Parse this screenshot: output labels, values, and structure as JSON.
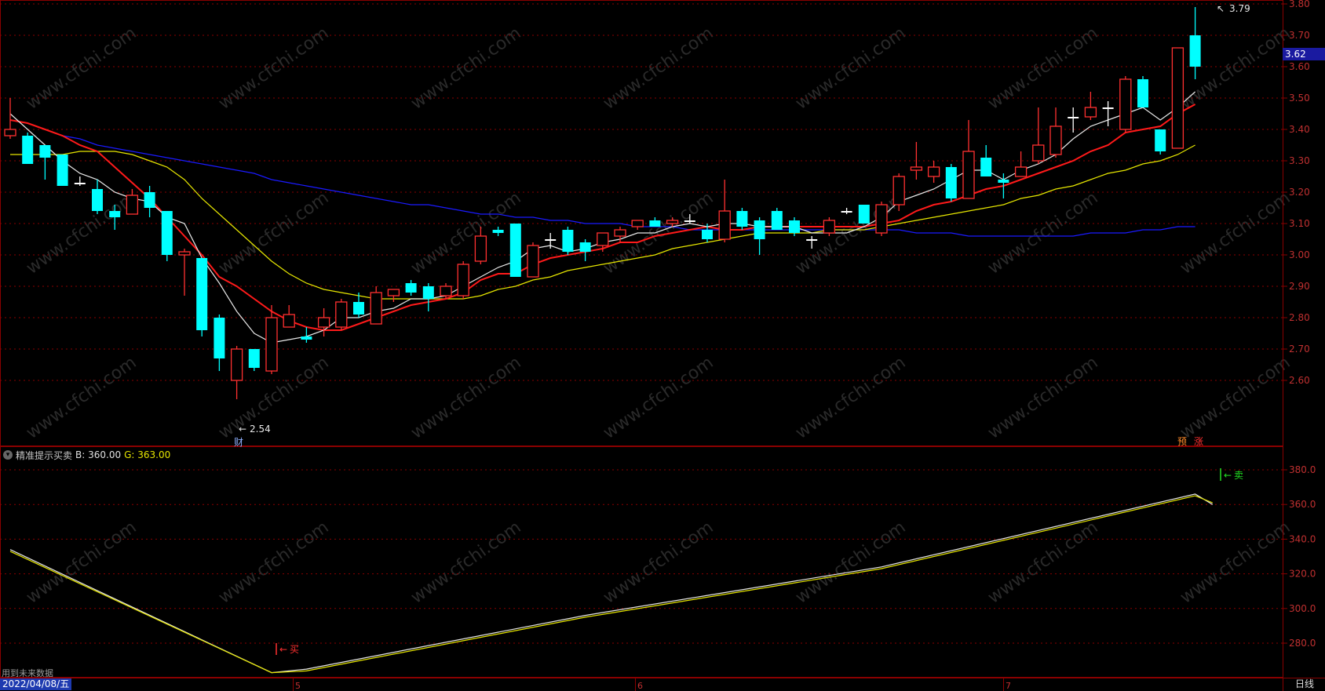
{
  "main_axis": {
    "ticks": [
      "3.80",
      "3.70",
      "3.60",
      "3.50",
      "3.40",
      "3.30",
      "3.20",
      "3.10",
      "3.00",
      "2.90",
      "2.80",
      "2.70",
      "2.60"
    ],
    "current_price": "3.62",
    "high_label": "3.79",
    "low_label": "2.54"
  },
  "markers": {
    "finance": "财",
    "forecast": "预",
    "rise": "涨"
  },
  "indicator": {
    "name": "精准提示买卖",
    "b_label": "B: 360.00",
    "g_label": "G: 363.00",
    "buy_signal": "买",
    "sell_signal": "卖",
    "axis_ticks": [
      "380.0",
      "360.0",
      "340.0",
      "320.0",
      "300.0",
      "280.0"
    ],
    "future_note": "用到未来数据"
  },
  "time_axis": {
    "date_label": "2022/04/08/五",
    "month_ticks": [
      "5",
      "6",
      "7"
    ],
    "period": "日线"
  },
  "watermark": "www.cfchi.com",
  "colors": {
    "up": "#ff3030",
    "down": "#00ffff",
    "ma5": "#e8e8e8",
    "ma10": "#ff1a1a",
    "ma20": "#e6e600",
    "ma60": "#1a1aff",
    "grid": "#8a0000"
  },
  "chart_data": {
    "type": "candlestick",
    "candles": [
      {
        "o": 3.38,
        "h": 3.5,
        "l": 3.37,
        "c": 3.4
      },
      {
        "o": 3.38,
        "h": 3.39,
        "l": 3.29,
        "c": 3.29
      },
      {
        "o": 3.35,
        "h": 3.35,
        "l": 3.24,
        "c": 3.31
      },
      {
        "o": 3.32,
        "h": 3.32,
        "l": 3.22,
        "c": 3.22
      },
      {
        "o": 3.23,
        "h": 3.25,
        "l": 3.22,
        "c": 3.23
      },
      {
        "o": 3.21,
        "h": 3.24,
        "l": 3.13,
        "c": 3.14
      },
      {
        "o": 3.14,
        "h": 3.16,
        "l": 3.08,
        "c": 3.12
      },
      {
        "o": 3.13,
        "h": 3.21,
        "l": 3.13,
        "c": 3.19
      },
      {
        "o": 3.2,
        "h": 3.22,
        "l": 3.12,
        "c": 3.15
      },
      {
        "o": 3.14,
        "h": 3.14,
        "l": 2.98,
        "c": 3.0
      },
      {
        "o": 3.0,
        "h": 3.02,
        "l": 2.87,
        "c": 3.01
      },
      {
        "o": 2.99,
        "h": 2.99,
        "l": 2.74,
        "c": 2.76
      },
      {
        "o": 2.8,
        "h": 2.81,
        "l": 2.63,
        "c": 2.67
      },
      {
        "o": 2.6,
        "h": 2.71,
        "l": 2.54,
        "c": 2.7
      },
      {
        "o": 2.7,
        "h": 2.7,
        "l": 2.63,
        "c": 2.64
      },
      {
        "o": 2.63,
        "h": 2.84,
        "l": 2.62,
        "c": 2.8
      },
      {
        "o": 2.77,
        "h": 2.84,
        "l": 2.77,
        "c": 2.81
      },
      {
        "o": 2.74,
        "h": 2.77,
        "l": 2.72,
        "c": 2.73
      },
      {
        "o": 2.77,
        "h": 2.83,
        "l": 2.74,
        "c": 2.8
      },
      {
        "o": 2.77,
        "h": 2.86,
        "l": 2.76,
        "c": 2.85
      },
      {
        "o": 2.85,
        "h": 2.88,
        "l": 2.8,
        "c": 2.81
      },
      {
        "o": 2.78,
        "h": 2.9,
        "l": 2.78,
        "c": 2.88
      },
      {
        "o": 2.87,
        "h": 2.89,
        "l": 2.85,
        "c": 2.89
      },
      {
        "o": 2.91,
        "h": 2.92,
        "l": 2.87,
        "c": 2.88
      },
      {
        "o": 2.9,
        "h": 2.91,
        "l": 2.82,
        "c": 2.86
      },
      {
        "o": 2.87,
        "h": 2.91,
        "l": 2.86,
        "c": 2.9
      },
      {
        "o": 2.87,
        "h": 2.98,
        "l": 2.86,
        "c": 2.97
      },
      {
        "o": 2.98,
        "h": 3.09,
        "l": 2.97,
        "c": 3.06
      },
      {
        "o": 3.08,
        "h": 3.09,
        "l": 3.06,
        "c": 3.07
      },
      {
        "o": 3.1,
        "h": 3.1,
        "l": 2.93,
        "c": 2.93
      },
      {
        "o": 2.93,
        "h": 3.04,
        "l": 2.93,
        "c": 3.03
      },
      {
        "o": 3.05,
        "h": 3.07,
        "l": 3.02,
        "c": 3.05
      },
      {
        "o": 3.08,
        "h": 3.09,
        "l": 3.0,
        "c": 3.01
      },
      {
        "o": 3.04,
        "h": 3.05,
        "l": 2.98,
        "c": 3.01
      },
      {
        "o": 3.03,
        "h": 3.07,
        "l": 3.01,
        "c": 3.07
      },
      {
        "o": 3.06,
        "h": 3.09,
        "l": 3.04,
        "c": 3.08
      },
      {
        "o": 3.09,
        "h": 3.11,
        "l": 3.08,
        "c": 3.11
      },
      {
        "o": 3.11,
        "h": 3.12,
        "l": 3.09,
        "c": 3.09
      },
      {
        "o": 3.1,
        "h": 3.12,
        "l": 3.09,
        "c": 3.11
      },
      {
        "o": 3.11,
        "h": 3.13,
        "l": 3.1,
        "c": 3.11
      },
      {
        "o": 3.08,
        "h": 3.1,
        "l": 3.04,
        "c": 3.05
      },
      {
        "o": 3.05,
        "h": 3.24,
        "l": 3.04,
        "c": 3.14
      },
      {
        "o": 3.14,
        "h": 3.15,
        "l": 3.08,
        "c": 3.09
      },
      {
        "o": 3.11,
        "h": 3.12,
        "l": 3.0,
        "c": 3.05
      },
      {
        "o": 3.14,
        "h": 3.15,
        "l": 3.08,
        "c": 3.08
      },
      {
        "o": 3.11,
        "h": 3.12,
        "l": 3.06,
        "c": 3.07
      },
      {
        "o": 3.05,
        "h": 3.06,
        "l": 3.02,
        "c": 3.05
      },
      {
        "o": 3.07,
        "h": 3.12,
        "l": 3.06,
        "c": 3.11
      },
      {
        "o": 3.14,
        "h": 3.15,
        "l": 3.13,
        "c": 3.14
      },
      {
        "o": 3.16,
        "h": 3.16,
        "l": 3.1,
        "c": 3.1
      },
      {
        "o": 3.07,
        "h": 3.17,
        "l": 3.06,
        "c": 3.16
      },
      {
        "o": 3.16,
        "h": 3.26,
        "l": 3.14,
        "c": 3.25
      },
      {
        "o": 3.27,
        "h": 3.36,
        "l": 3.24,
        "c": 3.28
      },
      {
        "o": 3.25,
        "h": 3.3,
        "l": 3.23,
        "c": 3.28
      },
      {
        "o": 3.28,
        "h": 3.29,
        "l": 3.17,
        "c": 3.18
      },
      {
        "o": 3.18,
        "h": 3.43,
        "l": 3.18,
        "c": 3.33
      },
      {
        "o": 3.31,
        "h": 3.35,
        "l": 3.25,
        "c": 3.25
      },
      {
        "o": 3.24,
        "h": 3.26,
        "l": 3.18,
        "c": 3.23
      },
      {
        "o": 3.25,
        "h": 3.33,
        "l": 3.25,
        "c": 3.28
      },
      {
        "o": 3.3,
        "h": 3.47,
        "l": 3.29,
        "c": 3.35
      },
      {
        "o": 3.32,
        "h": 3.47,
        "l": 3.31,
        "c": 3.41
      },
      {
        "o": 3.44,
        "h": 3.47,
        "l": 3.39,
        "c": 3.44
      },
      {
        "o": 3.44,
        "h": 3.52,
        "l": 3.43,
        "c": 3.47
      },
      {
        "o": 3.47,
        "h": 3.49,
        "l": 3.41,
        "c": 3.47
      },
      {
        "o": 3.4,
        "h": 3.57,
        "l": 3.39,
        "c": 3.56
      },
      {
        "o": 3.56,
        "h": 3.57,
        "l": 3.47,
        "c": 3.47
      },
      {
        "o": 3.4,
        "h": 3.4,
        "l": 3.32,
        "c": 3.33
      },
      {
        "o": 3.34,
        "h": 3.66,
        "l": 3.34,
        "c": 3.66
      },
      {
        "o": 3.7,
        "h": 3.79,
        "l": 3.56,
        "c": 3.6
      }
    ],
    "ma60": [
      3.43,
      3.42,
      3.4,
      3.38,
      3.37,
      3.35,
      3.34,
      3.33,
      3.32,
      3.31,
      3.3,
      3.29,
      3.28,
      3.27,
      3.26,
      3.24,
      3.23,
      3.22,
      3.21,
      3.2,
      3.19,
      3.18,
      3.17,
      3.16,
      3.16,
      3.15,
      3.14,
      3.13,
      3.13,
      3.12,
      3.12,
      3.11,
      3.11,
      3.1,
      3.1,
      3.1,
      3.09,
      3.09,
      3.09,
      3.08,
      3.08,
      3.08,
      3.08,
      3.08,
      3.08,
      3.08,
      3.08,
      3.08,
      3.08,
      3.08,
      3.08,
      3.08,
      3.07,
      3.07,
      3.07,
      3.06,
      3.06,
      3.06,
      3.06,
      3.06,
      3.06,
      3.06,
      3.07,
      3.07,
      3.07,
      3.08,
      3.08,
      3.09,
      3.09
    ],
    "ma20": [
      3.32,
      3.32,
      3.32,
      3.32,
      3.33,
      3.33,
      3.33,
      3.32,
      3.3,
      3.28,
      3.24,
      3.18,
      3.13,
      3.08,
      3.03,
      2.98,
      2.94,
      2.91,
      2.89,
      2.88,
      2.87,
      2.86,
      2.86,
      2.86,
      2.86,
      2.86,
      2.86,
      2.87,
      2.89,
      2.9,
      2.92,
      2.93,
      2.95,
      2.96,
      2.97,
      2.98,
      2.99,
      3.0,
      3.02,
      3.03,
      3.04,
      3.05,
      3.06,
      3.07,
      3.07,
      3.07,
      3.07,
      3.08,
      3.08,
      3.08,
      3.09,
      3.1,
      3.11,
      3.12,
      3.13,
      3.14,
      3.15,
      3.16,
      3.18,
      3.19,
      3.21,
      3.22,
      3.24,
      3.26,
      3.27,
      3.29,
      3.3,
      3.32,
      3.35
    ],
    "ma10": [
      3.43,
      3.42,
      3.4,
      3.38,
      3.35,
      3.33,
      3.28,
      3.23,
      3.18,
      3.12,
      3.06,
      3.0,
      2.93,
      2.9,
      2.86,
      2.82,
      2.79,
      2.77,
      2.76,
      2.76,
      2.78,
      2.8,
      2.82,
      2.84,
      2.85,
      2.86,
      2.88,
      2.92,
      2.94,
      2.94,
      2.97,
      2.99,
      3.0,
      3.01,
      3.02,
      3.04,
      3.04,
      3.06,
      3.07,
      3.08,
      3.09,
      3.08,
      3.08,
      3.09,
      3.09,
      3.09,
      3.09,
      3.09,
      3.09,
      3.09,
      3.1,
      3.11,
      3.14,
      3.16,
      3.17,
      3.19,
      3.21,
      3.22,
      3.24,
      3.26,
      3.28,
      3.3,
      3.33,
      3.35,
      3.39,
      3.4,
      3.41,
      3.45,
      3.48
    ],
    "ma5": [
      3.45,
      3.4,
      3.35,
      3.3,
      3.26,
      3.24,
      3.2,
      3.18,
      3.17,
      3.12,
      3.1,
      2.99,
      2.91,
      2.82,
      2.75,
      2.72,
      2.73,
      2.74,
      2.76,
      2.8,
      2.8,
      2.82,
      2.83,
      2.86,
      2.86,
      2.87,
      2.9,
      2.93,
      2.96,
      2.98,
      3.02,
      3.03,
      3.01,
      3.02,
      3.04,
      3.05,
      3.07,
      3.07,
      3.09,
      3.1,
      3.09,
      3.1,
      3.1,
      3.09,
      3.09,
      3.09,
      3.07,
      3.07,
      3.07,
      3.09,
      3.12,
      3.17,
      3.19,
      3.21,
      3.24,
      3.27,
      3.27,
      3.24,
      3.27,
      3.29,
      3.32,
      3.37,
      3.41,
      3.43,
      3.45,
      3.47,
      3.43,
      3.47,
      3.52
    ],
    "indicator_series": {
      "B": [
        [
          0,
          334
        ],
        [
          15,
          263
        ],
        [
          17,
          265
        ],
        [
          33,
          296
        ],
        [
          50,
          324
        ],
        [
          68,
          366
        ],
        [
          69,
          360
        ]
      ],
      "G": [
        [
          0,
          333
        ],
        [
          15,
          263
        ],
        [
          17,
          264
        ],
        [
          33,
          295
        ],
        [
          50,
          323
        ],
        [
          68,
          365
        ],
        [
          69,
          361
        ]
      ]
    },
    "indicator_ylim": [
      260,
      390
    ]
  }
}
